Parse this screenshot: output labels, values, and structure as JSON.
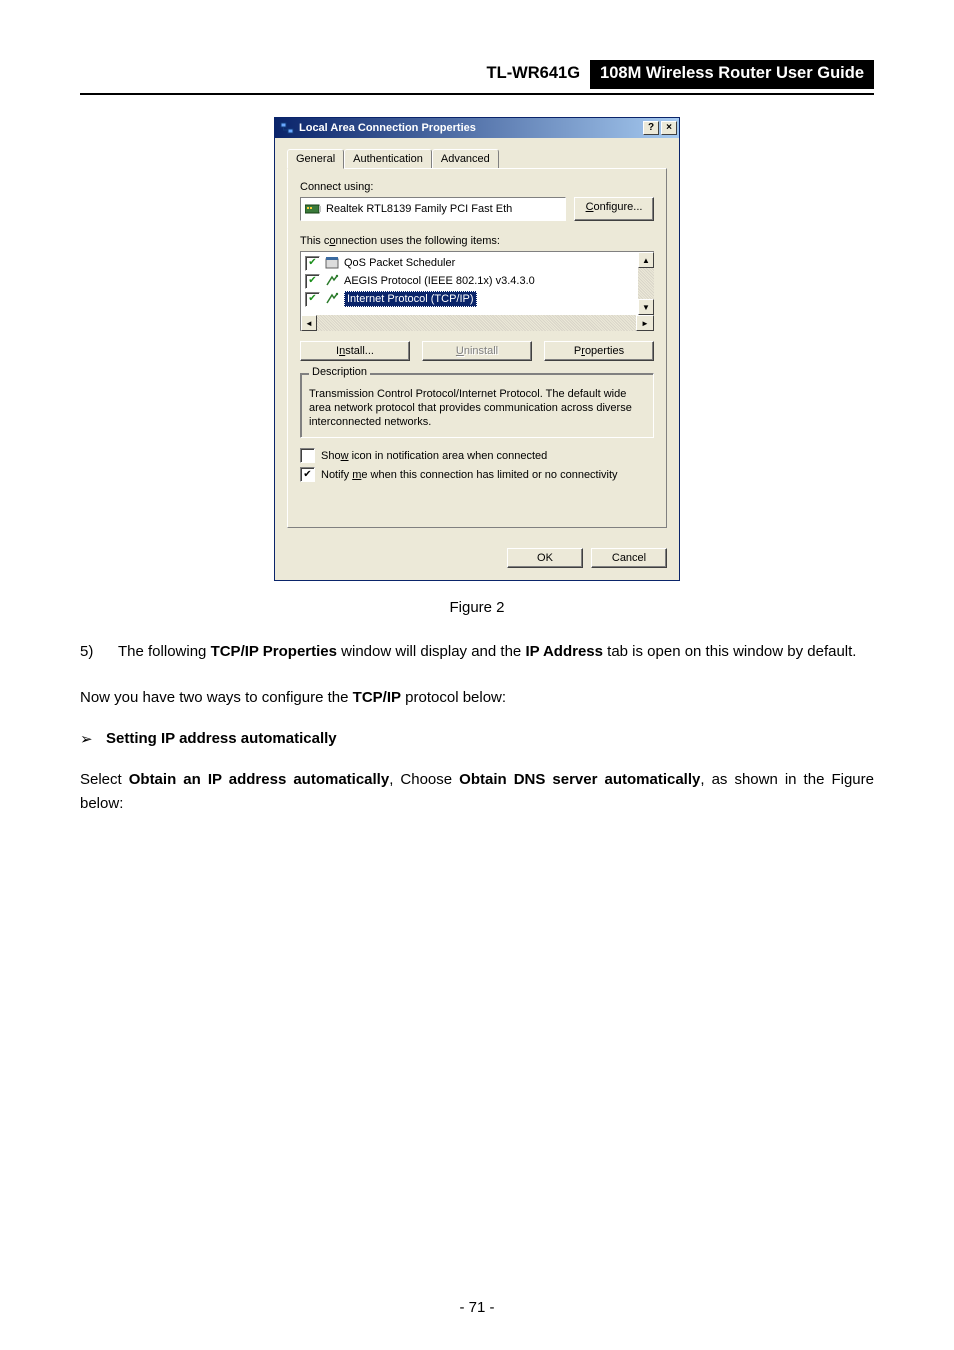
{
  "header": {
    "model": "TL-WR641G",
    "title": "108M Wireless Router User Guide"
  },
  "dialog": {
    "window_title": "Local Area Connection    Properties",
    "help_glyph": "?",
    "close_glyph": "×",
    "tabs": {
      "general": "General",
      "auth": "Authentication",
      "advanced": "Advanced"
    },
    "connect_using_label": "Connect using:",
    "adapter_name": "Realtek RTL8139 Family PCI Fast Eth",
    "configure_btn": "Configure...",
    "items_label": "This connection uses the following items:",
    "items": [
      {
        "label": "QoS Packet Scheduler"
      },
      {
        "label": "AEGIS Protocol (IEEE 802.1x) v3.4.3.0"
      },
      {
        "label": "Internet Protocol (TCP/IP)"
      }
    ],
    "install_btn": "Install...",
    "uninstall_btn": "Uninstall",
    "properties_btn": "Properties",
    "description_legend": "Description",
    "description_text": "Transmission Control Protocol/Internet Protocol. The default wide area network protocol that provides communication across diverse interconnected networks.",
    "show_icon_label": "Show icon in notification area when connected",
    "notify_label": "Notify me when this connection has limited or no connectivity",
    "ok_btn": "OK",
    "cancel_btn": "Cancel"
  },
  "figure_caption": "Figure 2",
  "list_item": {
    "number": "5)",
    "text_before": "The following ",
    "bold1": "TCP/IP Properties",
    "text_mid": " window will display and the ",
    "bold2": "IP Address",
    "text_after": " tab is open on this window by default."
  },
  "para1": {
    "before": "Now you have two ways to configure the ",
    "bold": "TCP/IP",
    "after": " protocol below:"
  },
  "bullet": {
    "arrow": "➢",
    "text": "Setting IP address automatically"
  },
  "para2": {
    "p1": "Select ",
    "b1": "Obtain an IP address automatically",
    "p2": ", Choose ",
    "b2": "Obtain DNS server automatically",
    "p3": ", as shown in the Figure below:"
  },
  "page_number": "- 71 -"
}
